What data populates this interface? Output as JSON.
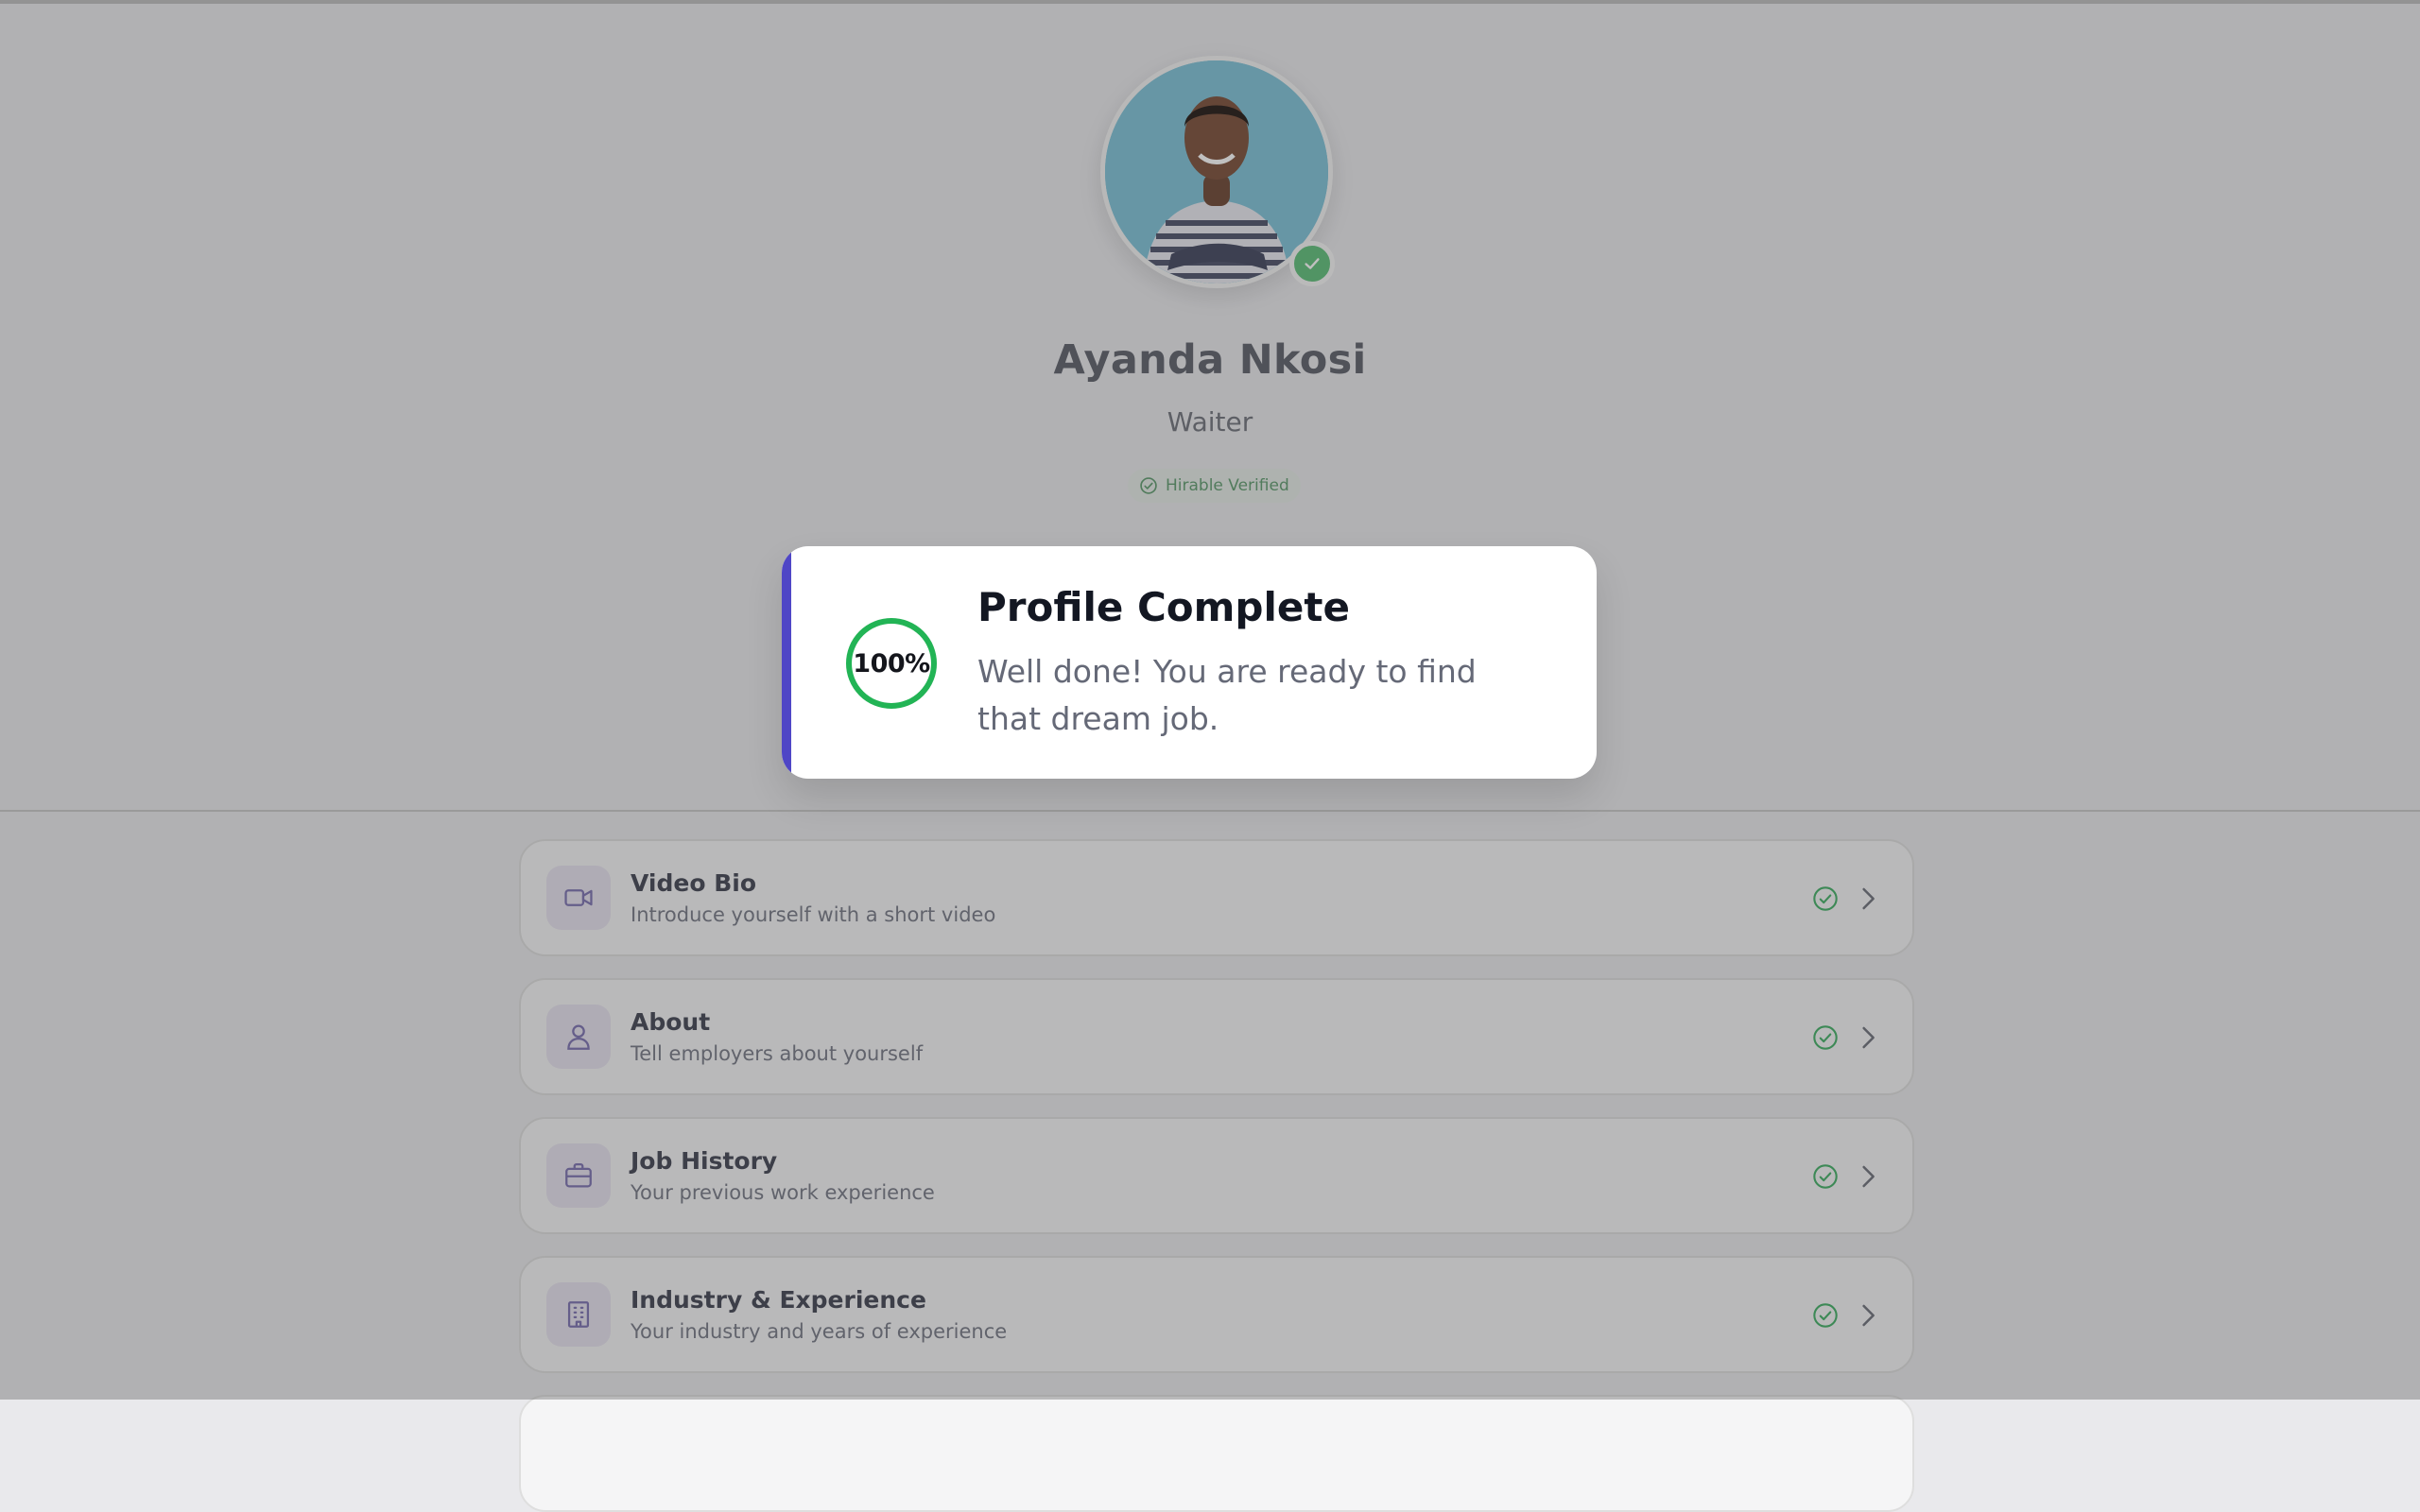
{
  "profile": {
    "name": "Ayanda Nkosi",
    "role": "Waiter",
    "verified_badge_label": "Hirable Verified"
  },
  "toast": {
    "progress_label": "100%",
    "progress_value": 1.0,
    "title": "Profile Complete",
    "message": "Well done! You are ready to find that dream job."
  },
  "sections": [
    {
      "title": "Video Bio",
      "description": "Introduce yourself with a short video",
      "icon": "video-icon",
      "complete": true
    },
    {
      "title": "About",
      "description": "Tell employers about yourself",
      "icon": "user-icon",
      "complete": true
    },
    {
      "title": "Job History",
      "description": "Your previous work experience",
      "icon": "briefcase-icon",
      "complete": true
    },
    {
      "title": "Industry & Experience",
      "description": "Your industry and years of experience",
      "icon": "building-icon",
      "complete": true
    }
  ],
  "colors": {
    "accent": "#4f46c6",
    "success": "#22b455",
    "icon_tint": "#7a6fb0"
  }
}
